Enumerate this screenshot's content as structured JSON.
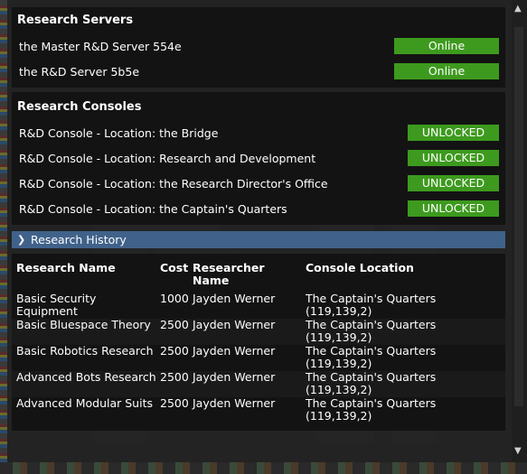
{
  "servers": {
    "title": "Research Servers",
    "items": [
      {
        "name": "the Master R&D Server 554e",
        "status": "Online"
      },
      {
        "name": "the R&D Server 5b5e",
        "status": "Online"
      }
    ]
  },
  "consoles": {
    "title": "Research Consoles",
    "items": [
      {
        "name": "R&D Console - Location: the Bridge",
        "status": "UNLOCKED"
      },
      {
        "name": "R&D Console - Location: Research and Development",
        "status": "UNLOCKED"
      },
      {
        "name": "R&D Console - Location: the Research Director's Office",
        "status": "UNLOCKED"
      },
      {
        "name": "R&D Console - Location: the Captain's Quarters",
        "status": "UNLOCKED"
      }
    ]
  },
  "history": {
    "title": "Research History",
    "columns": {
      "name": "Research Name",
      "cost": "Cost",
      "researcher_1": "Researcher",
      "researcher_2": "Name",
      "location": "Console Location"
    },
    "rows": [
      {
        "name_1": "Basic Security",
        "name_2": "Equipment",
        "cost": "1000",
        "researcher": "Jayden Werner",
        "location_1": "The Captain's Quarters",
        "location_2": "(119,139,2)"
      },
      {
        "name_1": "Basic Bluespace Theory",
        "name_2": "",
        "cost": "2500",
        "researcher": "Jayden Werner",
        "location_1": "The Captain's Quarters",
        "location_2": "(119,139,2)"
      },
      {
        "name_1": "Basic Robotics Research",
        "name_2": "",
        "cost": "2500",
        "researcher": "Jayden Werner",
        "location_1": "The Captain's Quarters",
        "location_2": "(119,139,2)"
      },
      {
        "name_1": "Advanced Bots Research",
        "name_2": "",
        "cost": "2500",
        "researcher": "Jayden Werner",
        "location_1": "The Captain's Quarters",
        "location_2": "(119,139,2)"
      },
      {
        "name_1": "Advanced Modular Suits",
        "name_2": "",
        "cost": "2500",
        "researcher": "Jayden Werner",
        "location_1": "The Captain's Quarters",
        "location_2": "(119,139,2)"
      }
    ]
  },
  "icons": {
    "collapse": "chevron-down-icon",
    "scroll_up": "scroll-up-icon",
    "scroll_down": "scroll-down-icon",
    "watermark": "nanotrasen-logo"
  },
  "colors": {
    "online": "#3d9a1e",
    "unlocked": "#3d9a1e",
    "history_header": "#40628a",
    "section_bg": "#131313",
    "window_bg": "#232323"
  }
}
